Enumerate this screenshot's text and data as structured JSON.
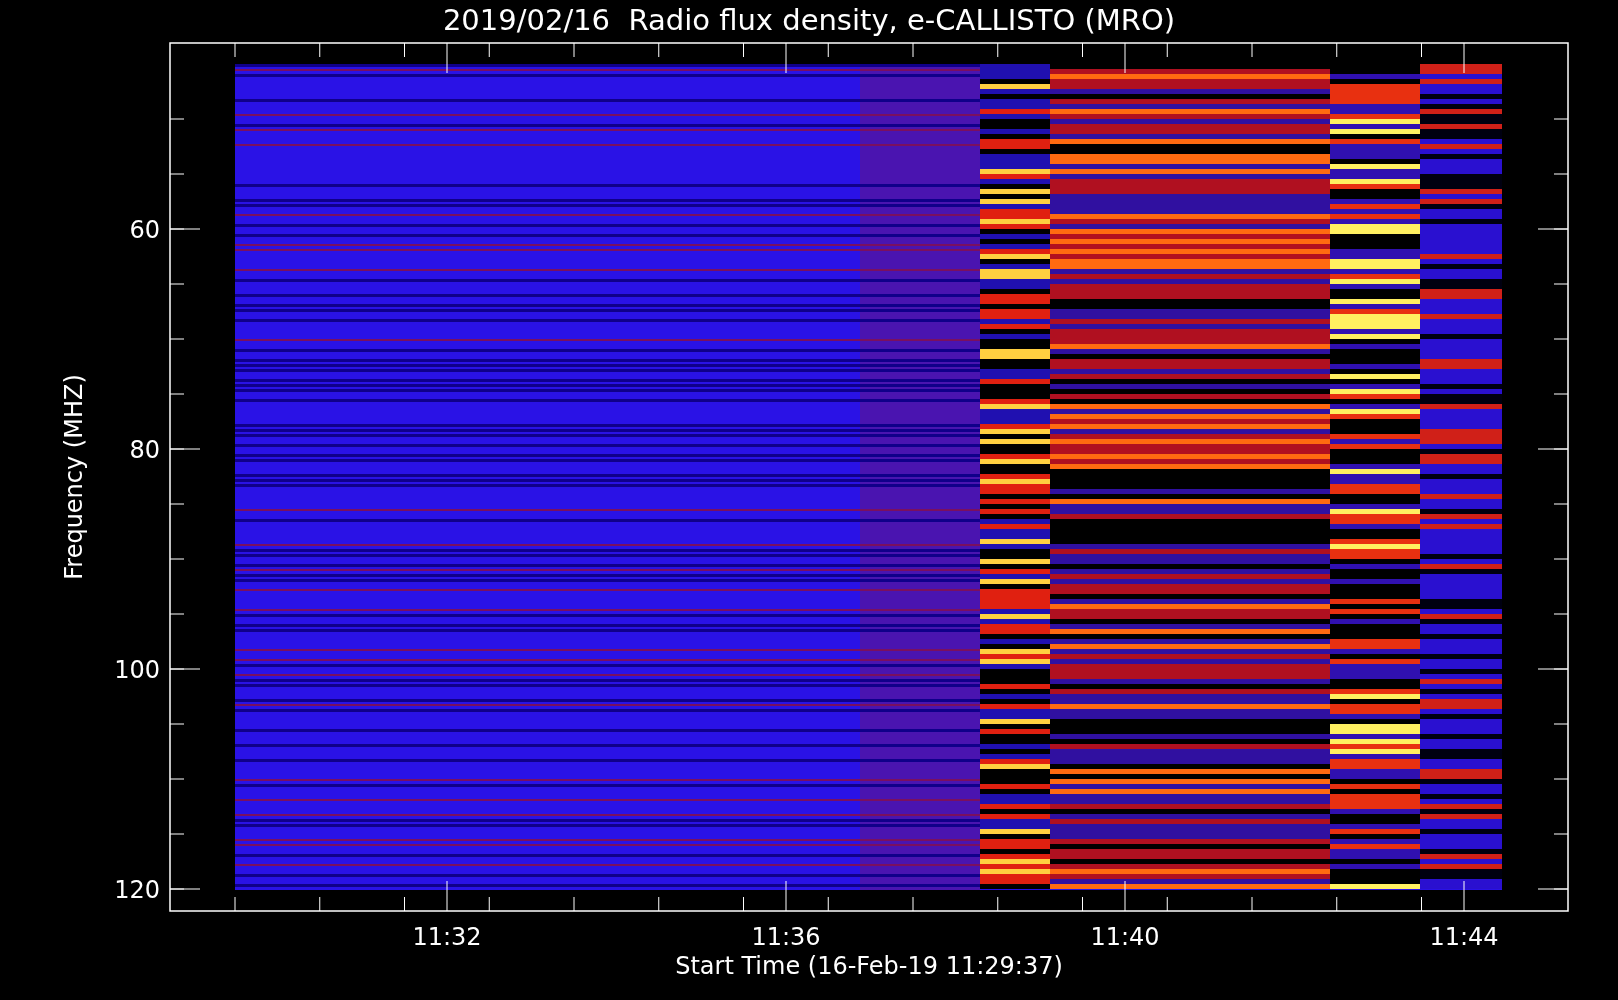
{
  "title": "2019/02/16  Radio flux density, e-CALLISTO (MRO)",
  "y_axis": {
    "label": "Frequency (MHZ)",
    "ticks": [
      "60",
      "80",
      "100",
      "120"
    ]
  },
  "x_axis": {
    "label": "Start Time (16-Feb-19 11:29:37)",
    "ticks": [
      "11:32",
      "11:36",
      "11:40",
      "11:44"
    ]
  }
}
